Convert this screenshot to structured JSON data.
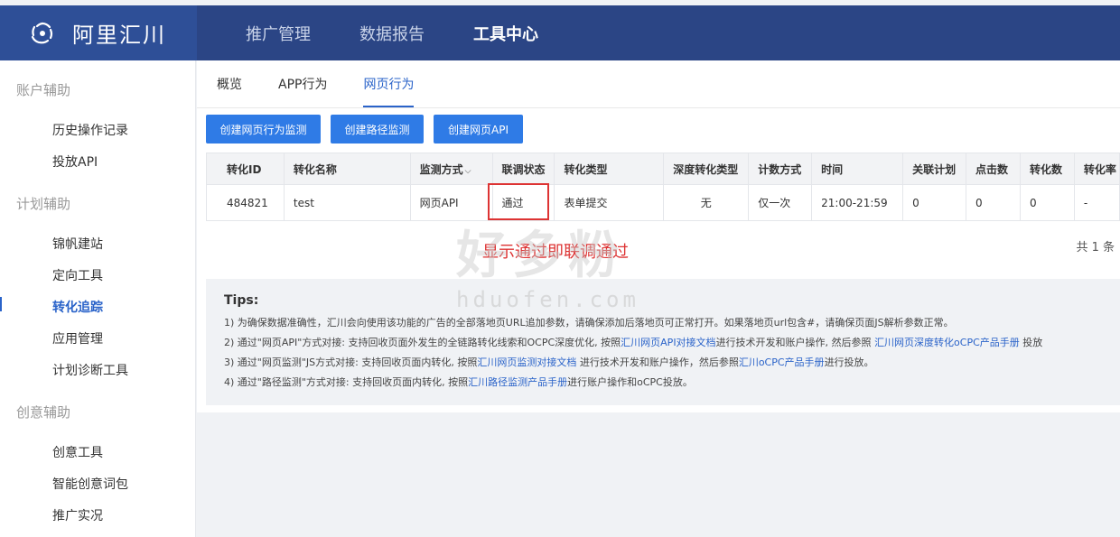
{
  "brand": {
    "name": "阿里汇川",
    "icon": "swirl-logo-icon"
  },
  "topnav": [
    "推广管理",
    "数据报告",
    "工具中心"
  ],
  "sidebar": {
    "groups": [
      {
        "title": "账户辅助",
        "items": [
          "历史操作记录",
          "投放API"
        ]
      },
      {
        "title": "计划辅助",
        "items": [
          "锦帆建站",
          "定向工具",
          "转化追踪",
          "应用管理",
          "计划诊断工具"
        ]
      },
      {
        "title": "创意辅助",
        "items": [
          "创意工具",
          "智能创意词包",
          "推广实况"
        ]
      }
    ],
    "active_item": "转化追踪"
  },
  "tabs": [
    "概览",
    "APP行为",
    "网页行为"
  ],
  "active_tab": "网页行为",
  "buttons": [
    "创建网页行为监测",
    "创建路径监测",
    "创建网页API"
  ],
  "table": {
    "headers": [
      "转化ID",
      "转化名称",
      "监测方式",
      "联调状态",
      "转化类型",
      "深度转化类型",
      "计数方式",
      "时间",
      "关联计划",
      "点击数",
      "转化数",
      "转化率"
    ],
    "rows": [
      [
        "484821",
        "test",
        "网页API",
        "通过",
        "表单提交",
        "无",
        "仅一次",
        "21:00-21:59",
        "0",
        "0",
        "0",
        "-"
      ]
    ]
  },
  "annotation": "显示通过即联调通过",
  "total": "共 1 条",
  "tips": {
    "title": "Tips:",
    "line1": "1) 为确保数据准确性，汇川会向使用该功能的广告的全部落地页URL追加参数，请确保添加后落地页可正常打开。如果落地页url包含#，请确保页面JS解析参数正常。",
    "line2_a": "2) 通过\"网页API\"方式对接: 支持回收页面外发生的全链路转化线索和OCPC深度优化, 按照",
    "line2_link1": "汇川网页API对接文档",
    "line2_b": "进行技术开发和账户操作, 然后参照 ",
    "line2_link2": "汇川网页深度转化oCPC产品手册",
    "line2_c": " 投放",
    "line3_a": "3) 通过\"网页监测\"JS方式对接: 支持回收页面内转化, 按照",
    "line3_link1": "汇川网页监测对接文档",
    "line3_b": " 进行技术开发和账户操作，然后参照",
    "line3_link2": "汇川oCPC产品手册",
    "line3_c": "进行投放。",
    "line4_a": "4) 通过\"路径监测\"方式对接: 支持回收页面内转化, 按照",
    "line4_link1": "汇川路径监测产品手册",
    "line4_b": "进行账户操作和oCPC投放。"
  },
  "watermark": {
    "text": "好多粉",
    "url": "hduofen.com"
  },
  "colors": {
    "topbar": "#2b4585",
    "brand": "#2e4f97",
    "accent": "#2f7be6",
    "annotation": "#dd3333"
  }
}
